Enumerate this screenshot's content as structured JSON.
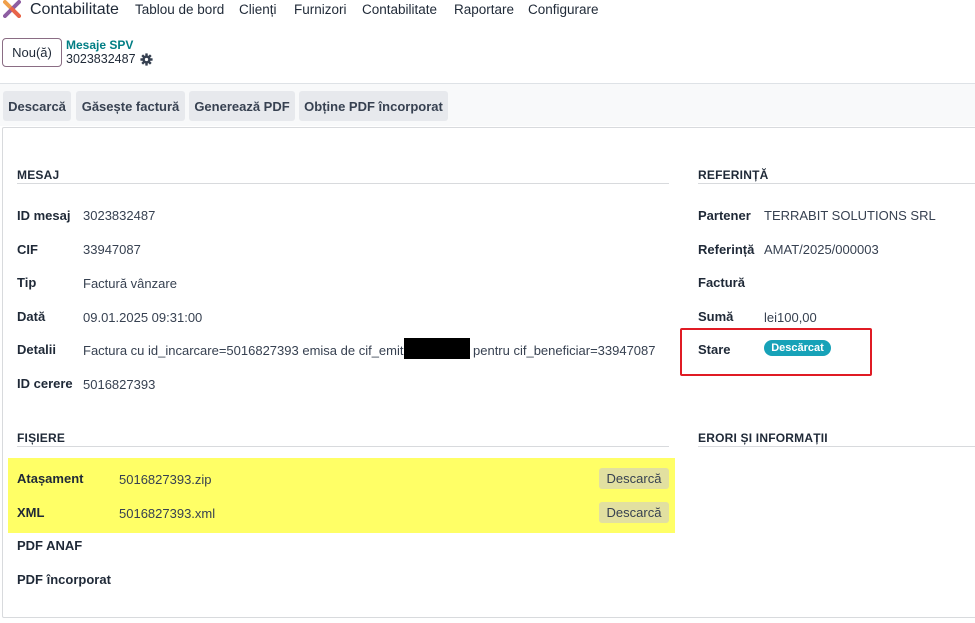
{
  "navbar": {
    "app_name": "Contabilitate",
    "menu": [
      "Tablou de bord",
      "Clienți",
      "Furnizori",
      "Contabilitate",
      "Raportare",
      "Configurare"
    ]
  },
  "control_panel": {
    "new_label": "Nou(ă)",
    "breadcrumb_link": "Mesaje SPV",
    "record_name": "3023832487"
  },
  "actions": [
    "Descarcă",
    "Găsește factură",
    "Generează PDF",
    "Obține PDF încorporat"
  ],
  "mesaj": {
    "title": "MESAJ",
    "fields": [
      {
        "label": "ID mesaj",
        "value": "3023832487"
      },
      {
        "label": "CIF",
        "value": "33947087"
      },
      {
        "label": "Tip",
        "value": "Factură vânzare"
      },
      {
        "label": "Dată",
        "value": "09.01.2025 09:31:00"
      },
      {
        "label": "Detalii",
        "value": "Factura cu id_incarcare=5016827393 emisa de cif_emitent",
        "value_after": "pentru cif_beneficiar=33947087"
      },
      {
        "label": "ID cerere",
        "value": "5016827393"
      }
    ]
  },
  "referinta": {
    "title": "REFERINȚĂ",
    "fields": [
      {
        "label": "Partener",
        "value": "TERRABIT SOLUTIONS SRL"
      },
      {
        "label": "Referință",
        "value": "AMAT/2025/000003"
      },
      {
        "label": "Factură",
        "value": ""
      },
      {
        "label": "Sumă",
        "value": "lei100,00"
      },
      {
        "label": "Stare",
        "value": "Descărcat"
      }
    ]
  },
  "fisiere": {
    "title": "FIȘIERE",
    "items": [
      {
        "label": "Atașament",
        "value": "5016827393.zip",
        "button": "Descarcă"
      },
      {
        "label": "XML",
        "value": "5016827393.xml",
        "button": "Descarcă"
      },
      {
        "label": "PDF ANAF",
        "value": ""
      },
      {
        "label": "PDF încorporat",
        "value": ""
      }
    ]
  },
  "erori": {
    "title": "ERORI ȘI INFORMAȚII"
  },
  "colors": {
    "brand": "#017e84",
    "status_badge": "#17a2b8",
    "highlight": "#ffff66",
    "annotation_red": "#e01b24"
  }
}
